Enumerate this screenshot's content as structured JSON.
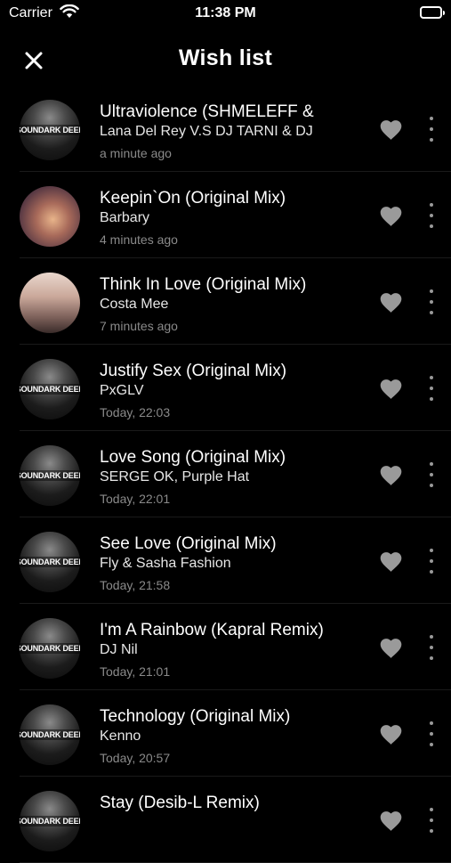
{
  "status_bar": {
    "carrier": "Carrier",
    "time": "11:38 PM"
  },
  "nav": {
    "title": "Wish list",
    "close_icon": "close-icon"
  },
  "art_text": "SOUNDARK DEEP",
  "colors": {
    "background": "#000000",
    "heart": "#9a9a9a",
    "secondary_text": "#8a8a8a"
  },
  "tracks": [
    {
      "title": "Ultraviolence (SHMELEFF &",
      "artist": "Lana Del Rey V.S DJ TARNI & DJ",
      "time": "a minute ago",
      "art": "dark"
    },
    {
      "title": "Keepin`On (Original Mix)",
      "artist": "Barbary",
      "time": "4 minutes ago",
      "art": "sunset"
    },
    {
      "title": "Think In Love (Original Mix)",
      "artist": "Costa Mee",
      "time": "7 minutes ago",
      "art": "mauve"
    },
    {
      "title": "Justify Sex (Original Mix)",
      "artist": "PxGLV",
      "time": "Today, 22:03",
      "art": "dark"
    },
    {
      "title": "Love Song (Original Mix)",
      "artist": "SERGE OK, Purple Hat",
      "time": "Today, 22:01",
      "art": "dark"
    },
    {
      "title": "See Love (Original Mix)",
      "artist": "Fly & Sasha Fashion",
      "time": "Today, 21:58",
      "art": "dark"
    },
    {
      "title": "I'm A Rainbow (Kapral Remix)",
      "artist": "DJ Nil",
      "time": "Today, 21:01",
      "art": "dark"
    },
    {
      "title": "Technology (Original Mix)",
      "artist": "Kenno",
      "time": "Today, 20:57",
      "art": "dark"
    },
    {
      "title": "Stay (Desib-L Remix)",
      "artist": "",
      "time": "",
      "art": "dark"
    }
  ]
}
